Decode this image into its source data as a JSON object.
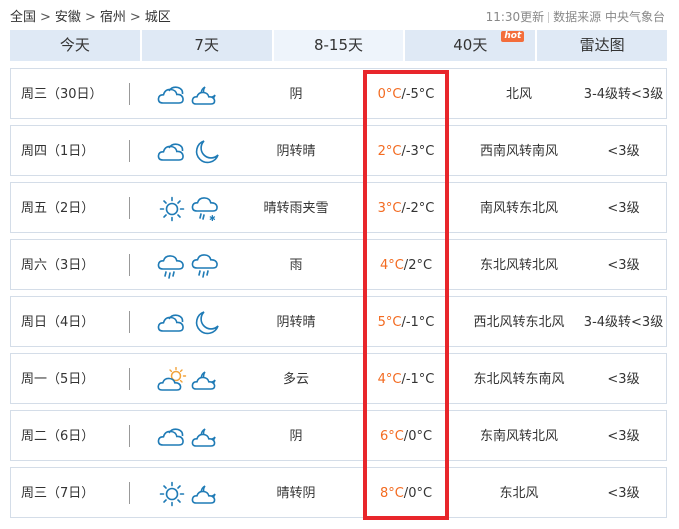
{
  "breadcrumb": {
    "items": [
      "全国",
      "安徽",
      "宿州",
      "城区"
    ],
    "separator": ">"
  },
  "source": {
    "update_time": "11:30更新",
    "data_source": "数据来源 中央气象台"
  },
  "tabs": [
    {
      "label": "今天",
      "active": false
    },
    {
      "label": "7天",
      "active": false
    },
    {
      "label": "8-15天",
      "active": true
    },
    {
      "label": "40天",
      "active": false,
      "badge": "hot"
    },
    {
      "label": "雷达图",
      "active": false
    }
  ],
  "colors": {
    "tab_bg": "#dfe9f5",
    "tab_active_bg": "#eef4fb",
    "high_temp": "#f36b21",
    "highlight_border": "#e8262b",
    "icon_stroke": "#1f7bb6",
    "sun": "#f2a33a",
    "badge": "#f36d3b"
  },
  "forecast": [
    {
      "date": "周三（30日）",
      "icon_day": "cloudy-icon",
      "icon_night": "partly-cloudy-night-icon",
      "weather": "阴",
      "high": "0°C",
      "low": "-5°C",
      "wind": "北风",
      "level": "3-4级转<3级"
    },
    {
      "date": "周四（1日）",
      "icon_day": "cloudy-icon",
      "icon_night": "moon-icon",
      "weather": "阴转晴",
      "high": "2°C",
      "low": "-3°C",
      "wind": "西南风转南风",
      "level": "<3级"
    },
    {
      "date": "周五（2日）",
      "icon_day": "sun-icon",
      "icon_night": "rain-snow-icon",
      "weather": "晴转雨夹雪",
      "high": "3°C",
      "low": "-2°C",
      "wind": "南风转东北风",
      "level": "<3级"
    },
    {
      "date": "周六（3日）",
      "icon_day": "rain-icon",
      "icon_night": "rain-icon",
      "weather": "雨",
      "high": "4°C",
      "low": "2°C",
      "wind": "东北风转北风",
      "level": "<3级"
    },
    {
      "date": "周日（4日）",
      "icon_day": "cloudy-icon",
      "icon_night": "moon-icon",
      "weather": "阴转晴",
      "high": "5°C",
      "low": "-1°C",
      "wind": "西北风转东北风",
      "level": "3-4级转<3级"
    },
    {
      "date": "周一（5日）",
      "icon_day": "partly-cloudy-day-icon",
      "icon_night": "partly-cloudy-night-icon",
      "weather": "多云",
      "high": "4°C",
      "low": "-1°C",
      "wind": "东北风转东南风",
      "level": "<3级"
    },
    {
      "date": "周二（6日）",
      "icon_day": "cloudy-icon",
      "icon_night": "partly-cloudy-night-icon",
      "weather": "阴",
      "high": "6°C",
      "low": "0°C",
      "wind": "东南风转北风",
      "level": "<3级"
    },
    {
      "date": "周三（7日）",
      "icon_day": "sun-icon",
      "icon_night": "partly-cloudy-night-icon",
      "weather": "晴转阴",
      "high": "8°C",
      "low": "0°C",
      "wind": "东北风",
      "level": "<3级"
    }
  ]
}
